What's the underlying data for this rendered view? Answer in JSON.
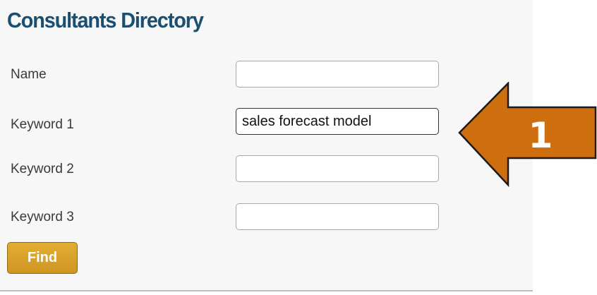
{
  "form": {
    "title": "Consultants Directory",
    "fields": [
      {
        "label": "Name",
        "value": ""
      },
      {
        "label": "Keyword 1",
        "value": "sales forecast model"
      },
      {
        "label": "Keyword 2",
        "value": ""
      },
      {
        "label": "Keyword 3",
        "value": ""
      }
    ],
    "submit_label": "Find"
  },
  "annotation": {
    "step_number": "1",
    "arrow_color": "#cf6e0f",
    "arrow_outline_color": "#1a1a1a"
  },
  "colors": {
    "title": "#1b4f72",
    "button": "#d9a12a",
    "panel_background": "#f7f7f7"
  }
}
